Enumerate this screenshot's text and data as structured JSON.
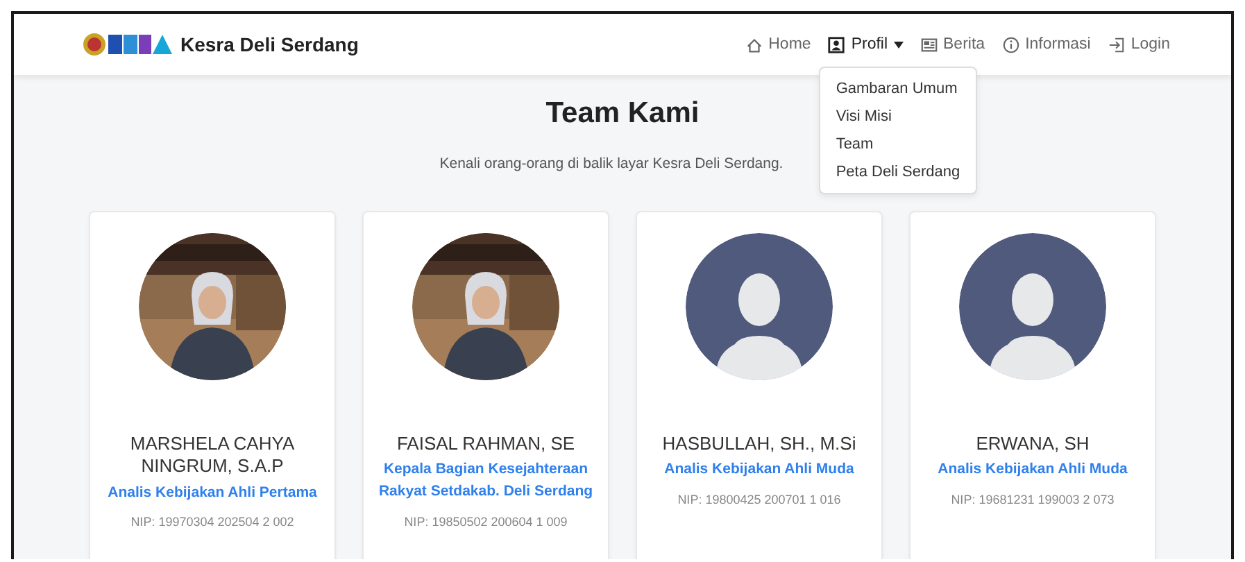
{
  "brand": {
    "name": "Kesra Deli Serdang"
  },
  "nav": [
    {
      "label": "Home",
      "selected": false
    },
    {
      "label": "Profil",
      "selected": true,
      "expanded": true,
      "menu": [
        "Gambaran Umum",
        "Visi Misi",
        "Team",
        "Peta Deli Serdang"
      ]
    },
    {
      "label": "Berita",
      "selected": false
    },
    {
      "label": "Informasi",
      "selected": false
    },
    {
      "label": "Login",
      "selected": false
    }
  ],
  "heading": "Team Kami",
  "subtitle": "Kenali orang-orang di balik layar Kesra Deli Serdang.",
  "members": [
    {
      "kind": "picture",
      "name": "MARSHELA CAHYA NINGRUM, S.A.P",
      "role": "Analis Kebijakan Ahli Pertama",
      "nip": "NIP: 19970304 202504 2 002"
    },
    {
      "kind": "picture",
      "name": "FAISAL RAHMAN, SE",
      "role": "Kepala Bagian Kesejahteraan Rakyat Setdakab. Deli Serdang",
      "nip": "NIP: 19850502 200604 1 009"
    },
    {
      "kind": "placeholder",
      "name": "HASBULLAH, SH., M.Si",
      "role": "Analis Kebijakan Ahli Muda",
      "nip": "NIP: 19800425 200701 1 016"
    },
    {
      "kind": "placeholder",
      "name": "ERWANA, SH",
      "role": "Analis Kebijakan Ahli Muda",
      "nip": "NIP: 19681231 199003 2 073"
    }
  ]
}
